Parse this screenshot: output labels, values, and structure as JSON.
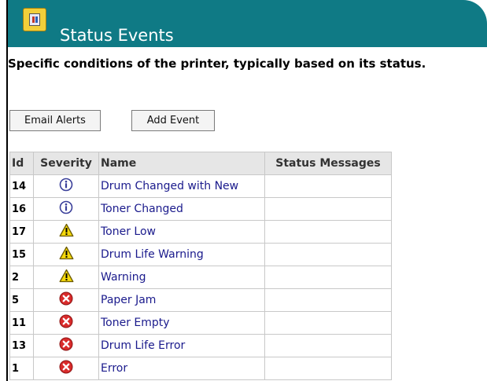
{
  "header": {
    "title": "Status Events",
    "accent_color": "#0f7a85",
    "icon": "status-events-icon"
  },
  "subtitle": "Specific conditions of the printer, typically based on its status.",
  "toolbar": {
    "email_alerts_label": "Email Alerts",
    "add_event_label": "Add Event"
  },
  "table": {
    "columns": [
      "Id",
      "Severity",
      "Name",
      "Status Messages"
    ],
    "rows": [
      {
        "id": "14",
        "severity": "info",
        "name": "Drum Changed with New",
        "status_messages": ""
      },
      {
        "id": "16",
        "severity": "info",
        "name": "Toner Changed",
        "status_messages": ""
      },
      {
        "id": "17",
        "severity": "warning",
        "name": "Toner Low",
        "status_messages": ""
      },
      {
        "id": "15",
        "severity": "warning",
        "name": "Drum Life Warning",
        "status_messages": ""
      },
      {
        "id": "2",
        "severity": "warning",
        "name": "Warning",
        "status_messages": ""
      },
      {
        "id": "5",
        "severity": "error",
        "name": "Paper Jam",
        "status_messages": ""
      },
      {
        "id": "11",
        "severity": "error",
        "name": "Toner Empty",
        "status_messages": ""
      },
      {
        "id": "13",
        "severity": "error",
        "name": "Drum Life Error",
        "status_messages": ""
      },
      {
        "id": "1",
        "severity": "error",
        "name": "Error",
        "status_messages": ""
      }
    ]
  },
  "severity_icons": {
    "info": "info-icon",
    "warning": "warning-icon",
    "error": "error-icon"
  },
  "colors": {
    "link": "#1a1a8c",
    "header_bg": "#0f7a85",
    "table_header_bg": "#e6e6e6",
    "warning": "#f5d90a",
    "error": "#d92b2b",
    "info": "#3a3f9a"
  }
}
